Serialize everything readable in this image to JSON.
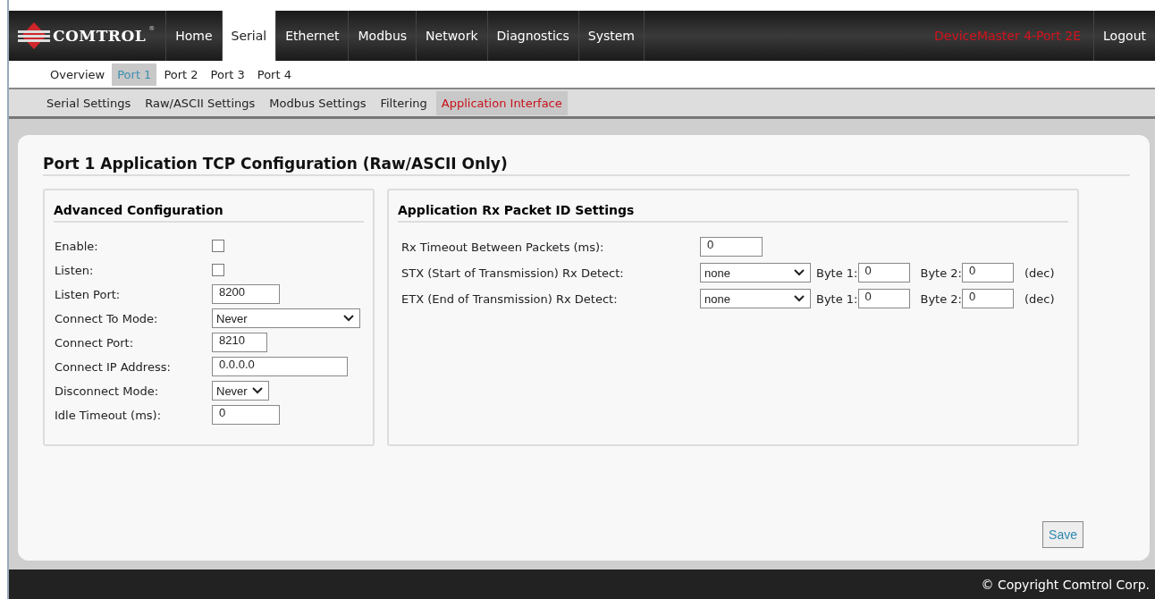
{
  "nav": {
    "logo": "COMTROL",
    "logo_mark": "®",
    "items": [
      {
        "label": "Home",
        "selected": false
      },
      {
        "label": "Serial",
        "selected": true
      },
      {
        "label": "Ethernet",
        "selected": false
      },
      {
        "label": "Modbus",
        "selected": false
      },
      {
        "label": "Network",
        "selected": false
      },
      {
        "label": "Diagnostics",
        "selected": false
      },
      {
        "label": "System",
        "selected": false
      }
    ],
    "device_name": "DeviceMaster 4-Port 2E",
    "logout": "Logout"
  },
  "port_tabs": [
    {
      "label": "Overview",
      "selected": false
    },
    {
      "label": "Port 1",
      "selected": true
    },
    {
      "label": "Port 2",
      "selected": false
    },
    {
      "label": "Port 3",
      "selected": false
    },
    {
      "label": "Port 4",
      "selected": false
    }
  ],
  "section_tabs": [
    {
      "label": "Serial Settings",
      "selected": false
    },
    {
      "label": "Raw/ASCII Settings",
      "selected": false
    },
    {
      "label": "Modbus Settings",
      "selected": false
    },
    {
      "label": "Filtering",
      "selected": false
    },
    {
      "label": "Application Interface",
      "selected": true
    }
  ],
  "page_title": "Port 1 Application TCP Configuration (Raw/ASCII Only)",
  "advanced": {
    "title": "Advanced Configuration",
    "fields": [
      {
        "kind": "checkbox",
        "label": "Enable:",
        "checked": false
      },
      {
        "kind": "checkbox",
        "label": "Listen:",
        "checked": false
      },
      {
        "kind": "text",
        "label": "Listen Port:",
        "value": "8200"
      },
      {
        "kind": "select",
        "label": "Connect To Mode:",
        "value": "Never"
      },
      {
        "kind": "text",
        "label": "Connect Port:",
        "value": "8210"
      },
      {
        "kind": "text",
        "label": "Connect IP Address:",
        "value": "0.0.0.0"
      },
      {
        "kind": "select",
        "label": "Disconnect Mode:",
        "value": "Never"
      },
      {
        "kind": "text",
        "label": "Idle Timeout (ms):",
        "value": "0"
      }
    ]
  },
  "rx": {
    "title": "Application Rx Packet ID Settings",
    "timeout": {
      "label": "Rx Timeout Between Packets (ms):",
      "value": "0"
    },
    "detects": [
      {
        "label": "STX (Start of Transmission) Rx Detect:",
        "mode": "none",
        "byte1_label": "Byte 1:",
        "byte1": "0",
        "byte2_label": "Byte 2:",
        "byte2": "0",
        "unit": "(dec)"
      },
      {
        "label": "ETX (End of Transmission) Rx Detect:",
        "mode": "none",
        "byte1_label": "Byte 1:",
        "byte1": "0",
        "byte2_label": "Byte 2:",
        "byte2": "0",
        "unit": "(dec)"
      }
    ]
  },
  "save": "Save",
  "footer": "© Copyright Comtrol Corp."
}
